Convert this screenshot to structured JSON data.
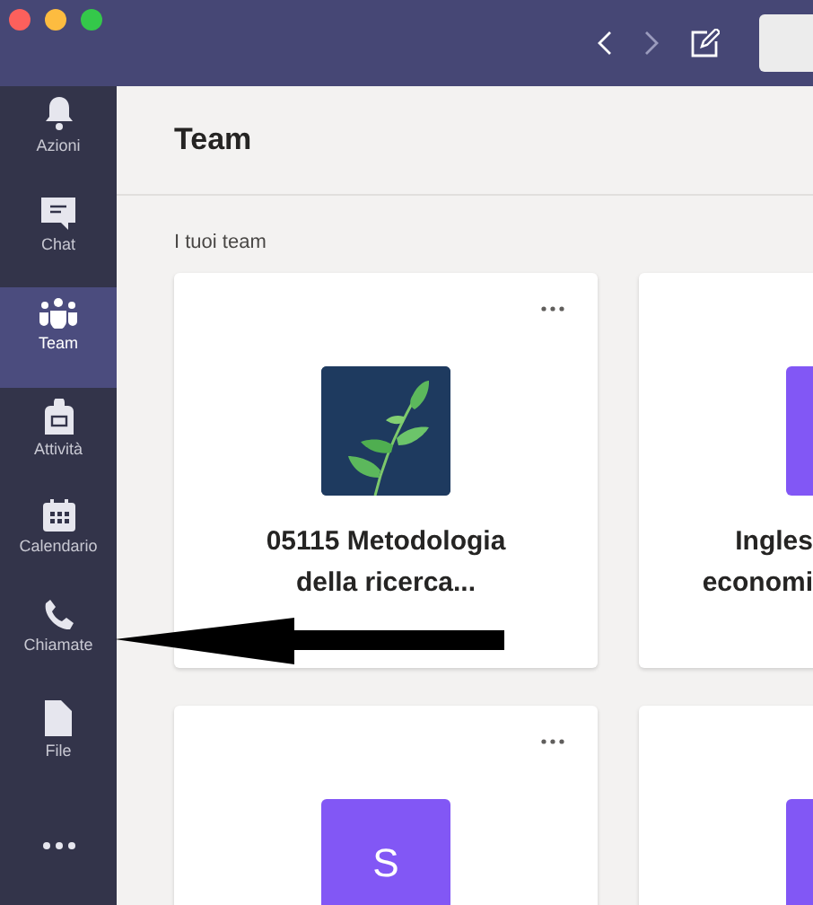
{
  "sidebar": {
    "items": [
      {
        "kind": "bell",
        "label": "Azioni",
        "selected": false
      },
      {
        "kind": "chat",
        "label": "Chat",
        "selected": false
      },
      {
        "kind": "team",
        "label": "Team",
        "selected": true
      },
      {
        "kind": "bag",
        "label": "Attività",
        "selected": false
      },
      {
        "kind": "calendar",
        "label": "Calendario",
        "selected": false
      },
      {
        "kind": "phone",
        "label": "Chiamate",
        "selected": false
      },
      {
        "kind": "file",
        "label": "File",
        "selected": false
      },
      {
        "kind": "more",
        "selected": false
      }
    ]
  },
  "header": {
    "title": "Team"
  },
  "section": {
    "label": "I tuoi team"
  },
  "teams": [
    {
      "name": "05115 Metodologia della ricerca..."
    },
    {
      "name": "Ingles economi",
      "avatar": {
        "kind": "letter",
        "color": "#8257f5"
      }
    },
    {
      "avatar": {
        "kind": "letter",
        "letter": "S",
        "color": "#8257f5"
      }
    },
    {
      "avatar": {
        "kind": "letter",
        "color": "#8257f5"
      }
    }
  ]
}
